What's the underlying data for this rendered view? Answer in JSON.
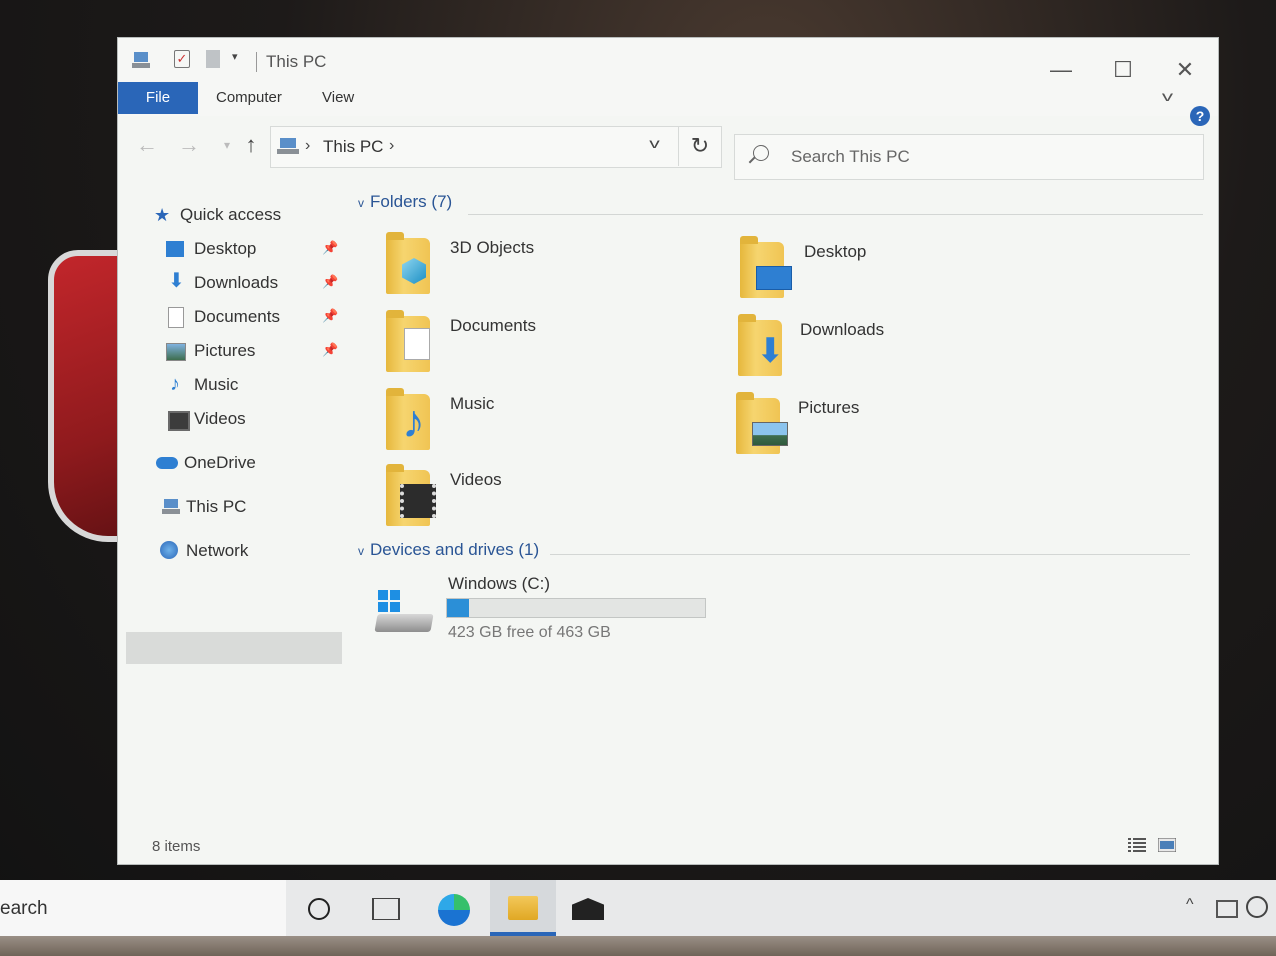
{
  "window": {
    "title": "This PC",
    "controls": {
      "minimize": "—",
      "maximize": "☐",
      "close": "✕"
    }
  },
  "ribbon": {
    "tabs": [
      "File",
      "Computer",
      "View"
    ],
    "help": "?"
  },
  "navigation": {
    "breadcrumb": "This PC",
    "search_placeholder": "Search This PC"
  },
  "sidebar": {
    "items": [
      {
        "label": "Quick access",
        "icon": "star-icon",
        "pinned": false
      },
      {
        "label": "Desktop",
        "icon": "desktop-icon",
        "pinned": true
      },
      {
        "label": "Downloads",
        "icon": "download-arrow-icon",
        "pinned": true
      },
      {
        "label": "Documents",
        "icon": "document-icon",
        "pinned": true
      },
      {
        "label": "Pictures",
        "icon": "picture-icon",
        "pinned": true
      },
      {
        "label": "Music",
        "icon": "music-note-icon",
        "pinned": false
      },
      {
        "label": "Videos",
        "icon": "film-icon",
        "pinned": false
      },
      {
        "label": "OneDrive",
        "icon": "cloud-icon",
        "pinned": false
      },
      {
        "label": "This PC",
        "icon": "computer-icon",
        "pinned": false,
        "selected": true
      },
      {
        "label": "Network",
        "icon": "network-icon",
        "pinned": false
      }
    ]
  },
  "main": {
    "folders_header": "Folders (7)",
    "folders": [
      {
        "label": "3D Objects",
        "badge": "cube-icon"
      },
      {
        "label": "Desktop",
        "badge": "desktop-icon"
      },
      {
        "label": "Documents",
        "badge": "document-icon"
      },
      {
        "label": "Downloads",
        "badge": "download-arrow-icon"
      },
      {
        "label": "Music",
        "badge": "music-note-icon"
      },
      {
        "label": "Pictures",
        "badge": "picture-icon"
      },
      {
        "label": "Videos",
        "badge": "film-icon"
      }
    ],
    "devices_header": "Devices and drives (1)",
    "drive": {
      "label": "Windows (C:)",
      "free_text": "423 GB free of 463 GB",
      "used_fraction": 0.086
    }
  },
  "status_bar": {
    "item_count": "8 items"
  },
  "taskbar": {
    "search_text": "earch",
    "apps": [
      "cortana-icon",
      "task-view-icon",
      "edge-icon",
      "file-explorer-icon",
      "mail-icon"
    ]
  },
  "colors": {
    "accent": "#2a66b8",
    "folder": "#f0c453",
    "header_text": "#2a5595",
    "drive_fill": "#2b8fd7"
  }
}
